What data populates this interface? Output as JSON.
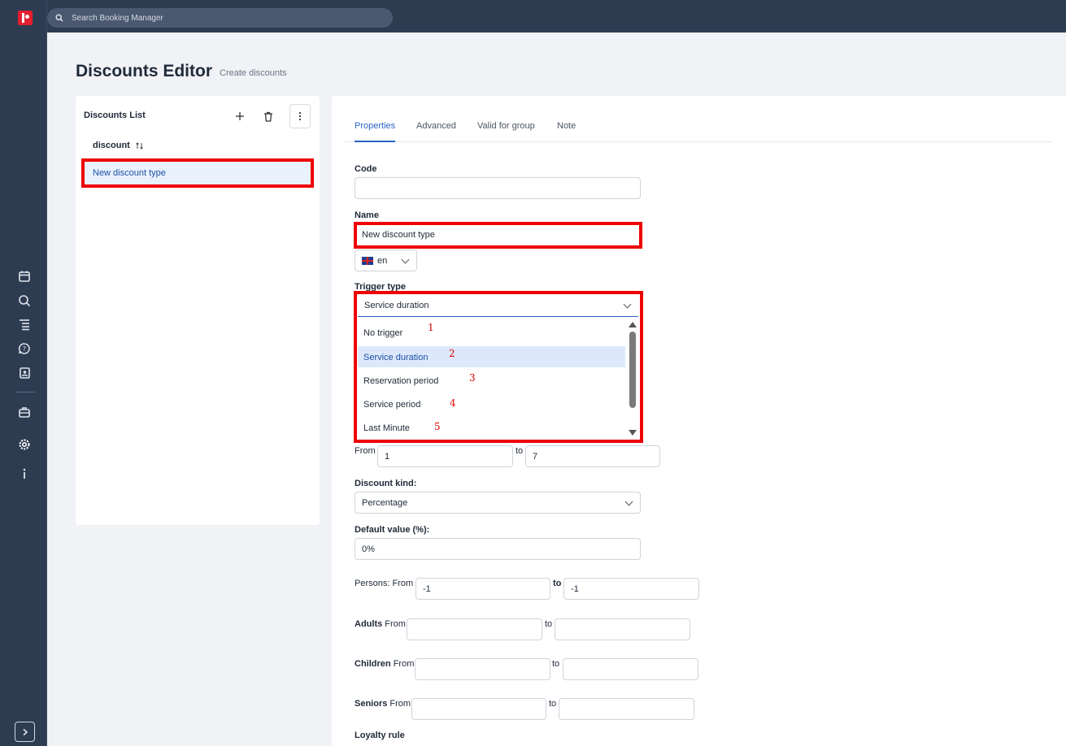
{
  "search": {
    "placeholder": "Search Booking Manager"
  },
  "page": {
    "title": "Discounts Editor",
    "subtitle": "Create discounts"
  },
  "list_panel": {
    "title": "Discounts List",
    "column_header": "discount",
    "items": [
      {
        "label": "New discount type"
      }
    ]
  },
  "tabs": [
    {
      "label": "Properties",
      "active": true
    },
    {
      "label": "Advanced"
    },
    {
      "label": "Valid for group"
    },
    {
      "label": "Note"
    }
  ],
  "form": {
    "code_label": "Code",
    "code_value": "",
    "name_label": "Name",
    "name_value": "New discount type",
    "language": "en",
    "trigger_label": "Trigger type",
    "trigger_value": "Service duration",
    "trigger_options": [
      {
        "label": "No trigger",
        "marker": "1"
      },
      {
        "label": "Service duration",
        "marker": "2",
        "selected": true
      },
      {
        "label": "Reservation period",
        "marker": "3"
      },
      {
        "label": "Service period",
        "marker": "4"
      },
      {
        "label": "Last Minute",
        "marker": "5"
      }
    ],
    "from_label": "From",
    "from_value": "1",
    "to_label": "to",
    "to_value": "7",
    "discount_kind_label": "Discount kind:",
    "discount_kind_value": "Percentage",
    "default_value_label": "Default value (%):",
    "default_value": "0%",
    "persons_label": "Persons: From",
    "persons_from": "-1",
    "persons_to": "-1",
    "adults_label": "Adults",
    "children_label": "Children",
    "seniors_label": "Seniors",
    "from_word": "From",
    "loyalty_label": "Loyalty rule"
  },
  "colors": {
    "accent": "#2a63c6",
    "highlight": "#ee0000",
    "sidebar": "#2e3c52"
  }
}
